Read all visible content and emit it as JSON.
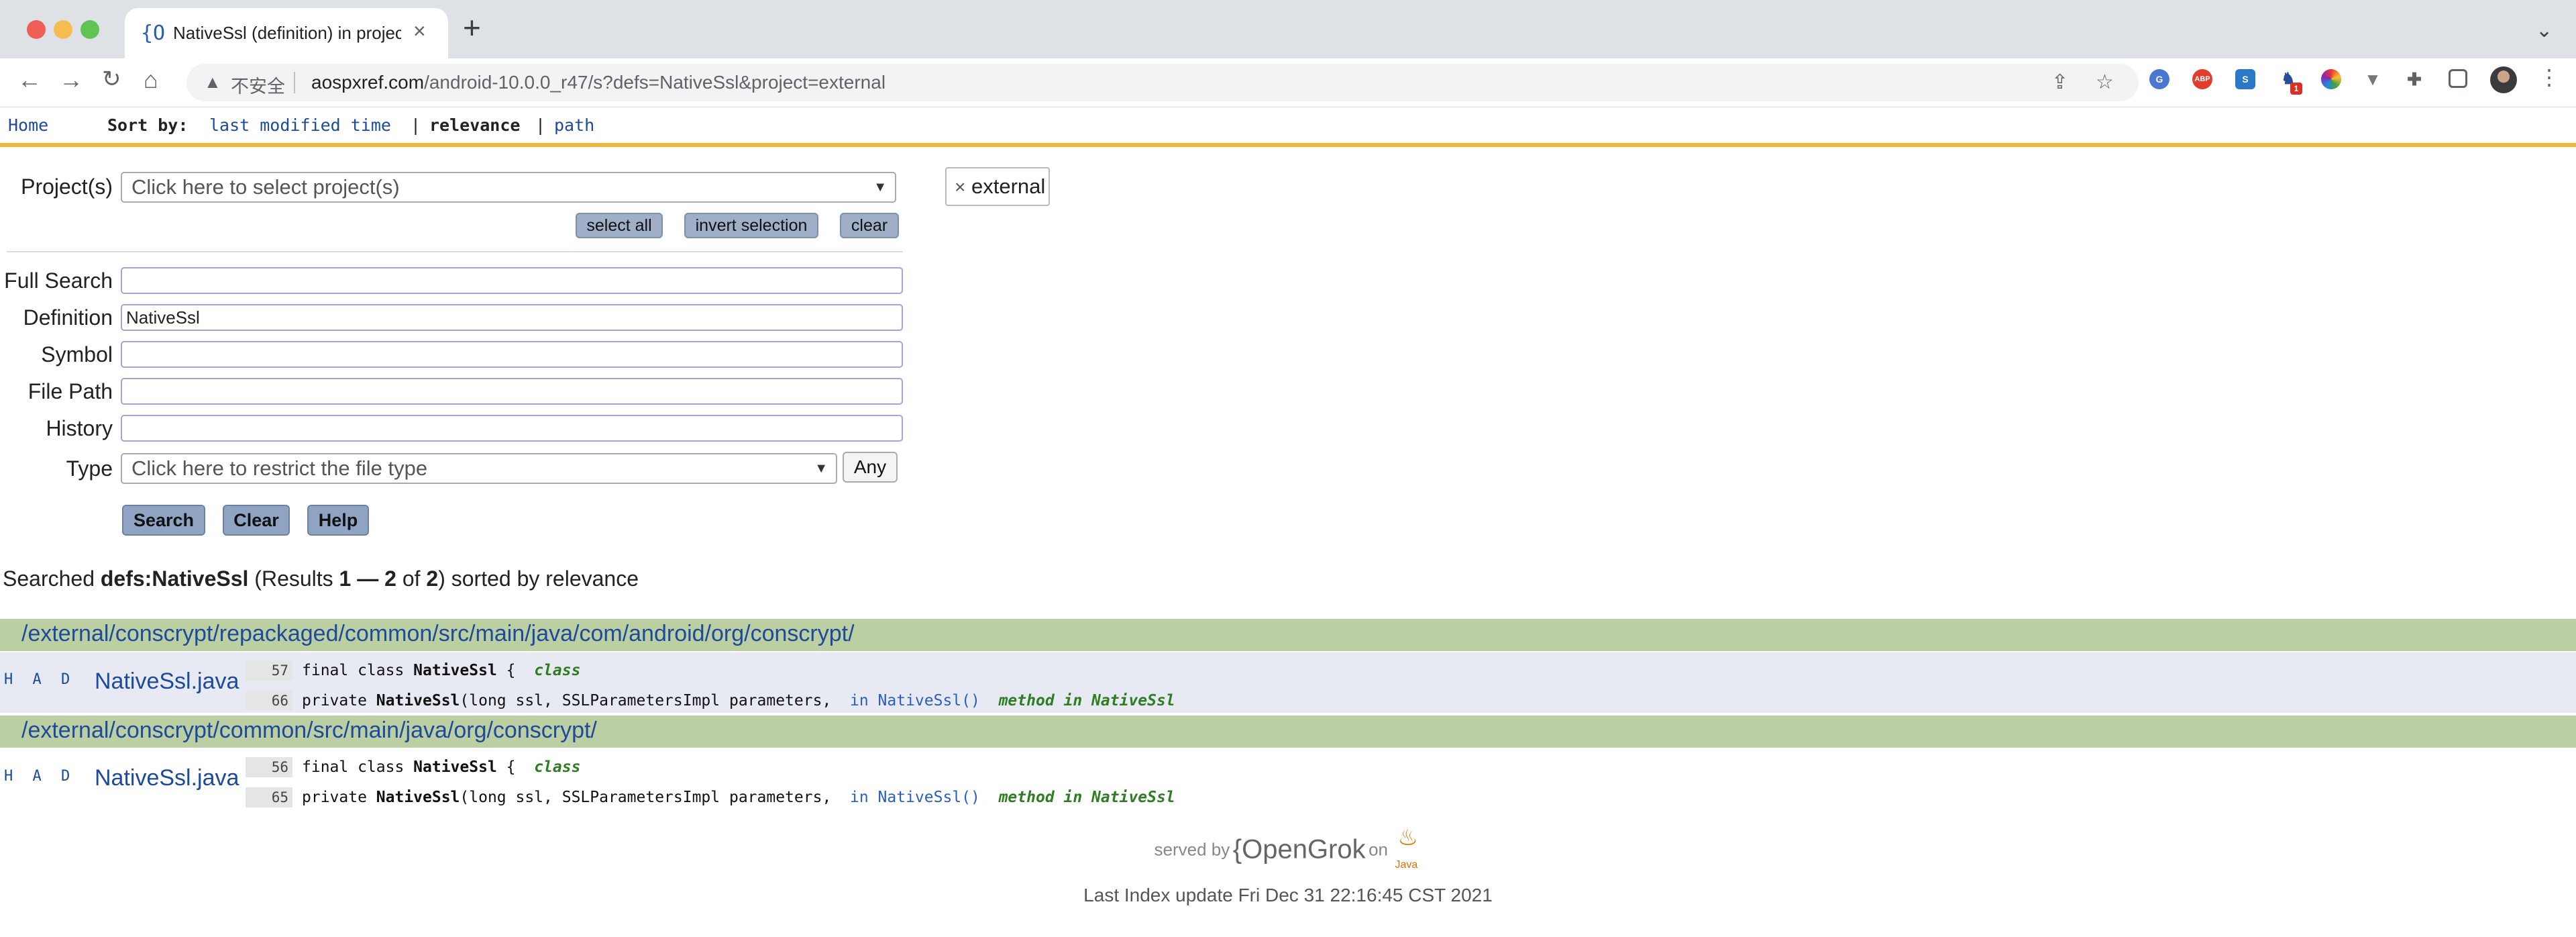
{
  "browser": {
    "tab_title": "NativeSsl (definition) in project",
    "tab_favicon": "{O",
    "insecure_label": "不安全",
    "url_host": "aospxref.com",
    "url_rest": "/android-10.0.0_r47/s?defs=NativeSsl&project=external",
    "ext_labels": [
      "ABP",
      "S",
      "1"
    ]
  },
  "nav": {
    "home": "Home",
    "sort_by": "Sort by:",
    "sort_last_modified": "last modified time",
    "sort_relevance": "relevance",
    "sort_path": "path",
    "pipe": "|"
  },
  "search_form": {
    "projects_label": "Project(s)",
    "projects_placeholder": "Click here to select project(s)",
    "select_all": "select all",
    "invert_selection": "invert selection",
    "clear_small": "clear",
    "selected_project": "external",
    "chip_remove": "×",
    "full_search_label": "Full Search",
    "full_search_value": "",
    "definition_label": "Definition",
    "definition_value": "NativeSsl",
    "symbol_label": "Symbol",
    "symbol_value": "",
    "file_path_label": "File Path",
    "file_path_value": "",
    "history_label": "History",
    "history_value": "",
    "type_label": "Type",
    "type_placeholder": "Click here to restrict the file type",
    "any_button": "Any",
    "search_button": "Search",
    "clear_button": "Clear",
    "help_button": "Help"
  },
  "summary": {
    "prefix": "Searched",
    "query": "defs:NativeSsl",
    "results_open": "(Results",
    "from": "1",
    "dash": "—",
    "to": "2",
    "of_text": "of",
    "total": "2",
    "results_close": ")",
    "suffix": "sorted by relevance"
  },
  "results": [
    {
      "dir": "/external/conscrypt/repackaged/common/src/main/java/com/android/org/conscrypt/",
      "had": "H A D",
      "file": "NativeSsl.java",
      "lines": [
        {
          "no": "57",
          "pre": "final class ",
          "bold": "NativeSsl",
          "post": " {",
          "in_text": "",
          "tag": "class"
        },
        {
          "no": "66",
          "pre": "private ",
          "bold": "NativeSsl",
          "post": "(long ssl, SSLParametersImpl parameters,",
          "in_text": "in NativeSsl()",
          "tag": "method in NativeSsl"
        }
      ]
    },
    {
      "dir": "/external/conscrypt/common/src/main/java/org/conscrypt/",
      "had": "H A D",
      "file": "NativeSsl.java",
      "lines": [
        {
          "no": "56",
          "pre": "final class ",
          "bold": "NativeSsl",
          "post": " {",
          "in_text": "",
          "tag": "class"
        },
        {
          "no": "65",
          "pre": "private ",
          "bold": "NativeSsl",
          "post": "(long ssl, SSLParametersImpl parameters,",
          "in_text": "in NativeSsl()",
          "tag": "method in NativeSsl"
        }
      ]
    }
  ],
  "footer": {
    "served_by": "served by",
    "opengrok": "{OpenGrok",
    "on": "on",
    "java": "Java",
    "last_index": "Last Index update Fri Dec 31 22:16:45 CST 2021"
  },
  "colors": {
    "link": "#1c4a9c",
    "dir_bar": "#bccfa2",
    "result_bg": "#e8eaf3",
    "orange_rule": "#f3b73b",
    "tag_green": "#2e7d23"
  }
}
